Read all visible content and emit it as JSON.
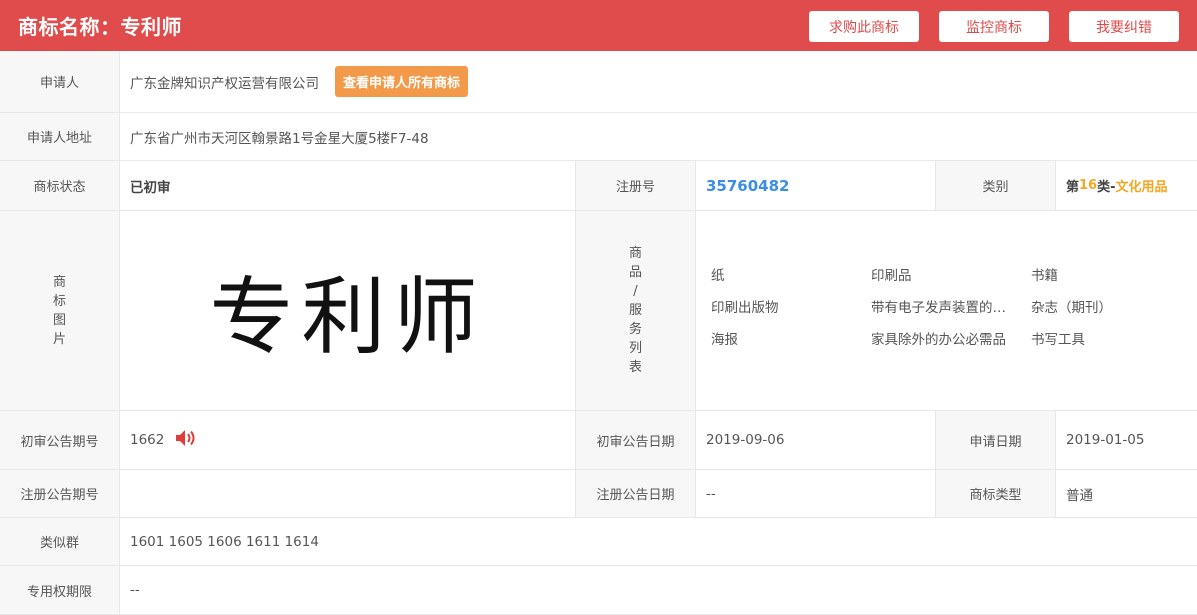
{
  "header": {
    "title": "商标名称：专利师",
    "buttons": [
      "求购此商标",
      "监控商标",
      "我要纠错"
    ]
  },
  "applicant": {
    "label": "申请人",
    "value": "广东金牌知识产权运营有限公司",
    "button": "查看申请人所有商标"
  },
  "address": {
    "label": "申请人地址",
    "value": "广东省广州市天河区翰景路1号金星大厦5楼F7-48"
  },
  "status": {
    "label": "商标状态",
    "value": "已初审",
    "reg_label": "注册号",
    "reg_value": "35760482",
    "class_label": "类别",
    "class_prefix": "第",
    "class_num": "16",
    "class_mid": "类-",
    "class_name": "文化用品"
  },
  "image": {
    "label_chars": [
      "商",
      "标",
      "图",
      "片"
    ],
    "mark_text": "专利师",
    "goods_label_chars": [
      "商",
      "品",
      "/",
      "服",
      "务",
      "列",
      "表"
    ],
    "goods": [
      "纸",
      "印刷品",
      "书籍",
      "印刷出版物",
      "带有电子发声装置的儿童书籍",
      "杂志（期刊）",
      "海报",
      "家具除外的办公必需品",
      "书写工具"
    ]
  },
  "prelim": {
    "label": "初审公告期号",
    "value": "1662",
    "date_label": "初审公告日期",
    "date_value": "2019-09-06",
    "apply_label": "申请日期",
    "apply_value": "2019-01-05"
  },
  "registration": {
    "label": "注册公告期号",
    "value": "",
    "date_label": "注册公告日期",
    "date_value": "--",
    "type_label": "商标类型",
    "type_value": "普通"
  },
  "similar": {
    "label": "类似群",
    "value": "1601 1605 1606 1611 1614"
  },
  "term": {
    "label": "专用权期限",
    "value": "--"
  },
  "colors": {
    "header_bg": "#e04b4b",
    "orange": "#f39a4a",
    "reg_blue": "#3a8ee6",
    "class_orange": "#f5a623"
  }
}
